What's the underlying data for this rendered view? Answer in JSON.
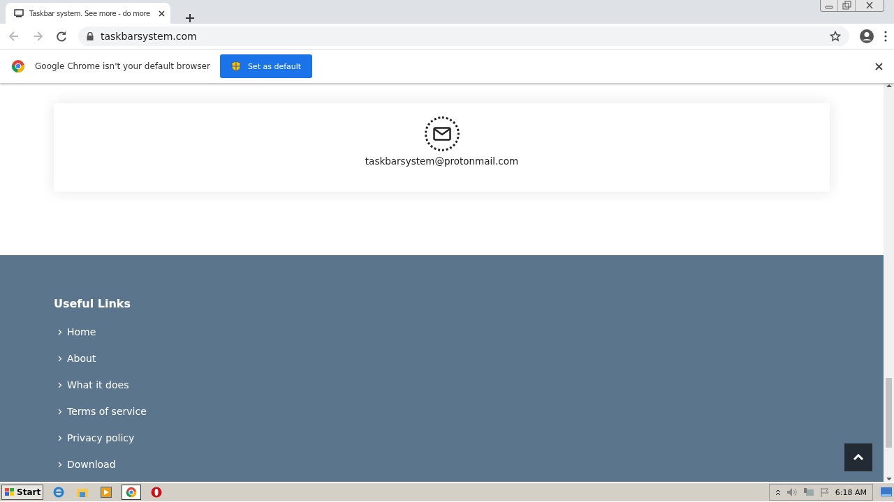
{
  "browser": {
    "tab_title": "Taskbar system. See more - do more",
    "url": "taskbarsystem.com"
  },
  "infobar": {
    "message": "Google Chrome isn't your default browser",
    "button": "Set as default"
  },
  "contact": {
    "email": "taskbarsystem@protonmail.com"
  },
  "footer": {
    "heading": "Useful Links",
    "links": [
      "Home",
      "About",
      "What it does",
      "Terms of service",
      "Privacy policy",
      "Download"
    ]
  },
  "taskbar": {
    "start": "Start",
    "clock": "6:18 AM"
  }
}
